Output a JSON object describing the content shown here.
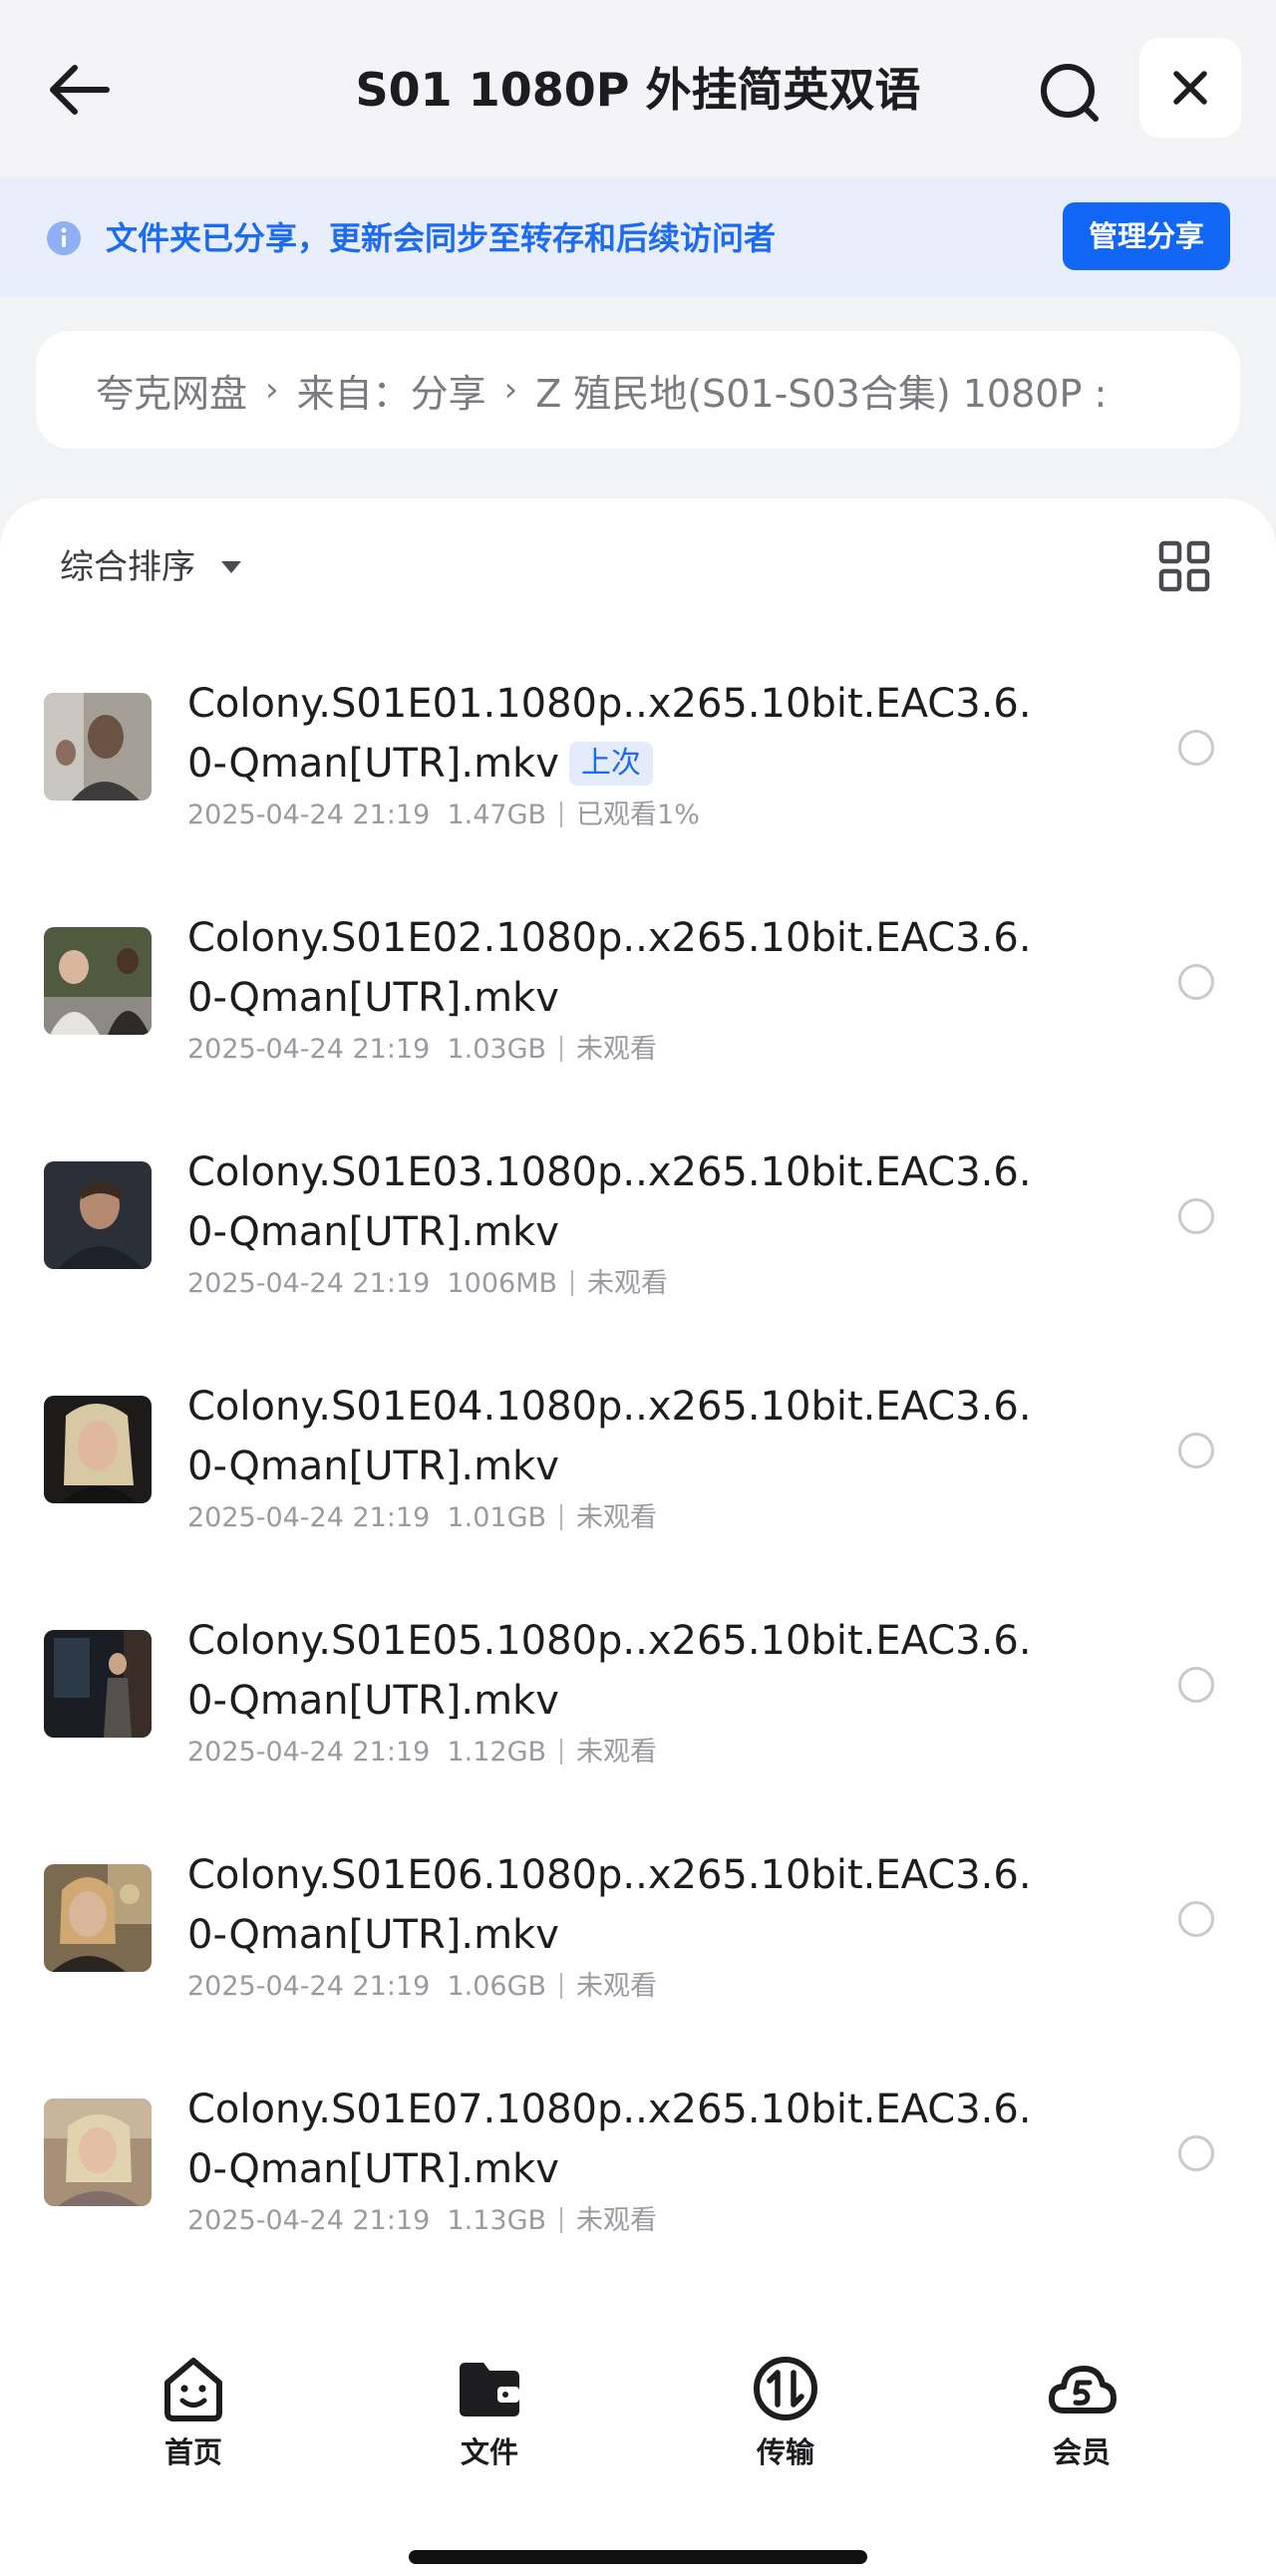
{
  "header": {
    "title": "S01 1080P 外挂简英双语"
  },
  "notice": {
    "text": "文件夹已分享，更新会同步至转存和后续访问者",
    "button": "管理分享"
  },
  "breadcrumb": {
    "items": [
      "夸克网盘",
      "来自：分享",
      "Z 殖民地(S01-S03合集) 1080P :"
    ]
  },
  "sort": {
    "label": "综合排序"
  },
  "files": [
    {
      "name": "Colony.S01E01.1080p..x265.10bit.EAC3.6.0-Qman[UTR].mkv",
      "date": "2025-04-24 21:19",
      "size": "1.47GB",
      "status": "已观看1%",
      "tag": "上次"
    },
    {
      "name": "Colony.S01E02.1080p..x265.10bit.EAC3.6.0-Qman[UTR].mkv",
      "date": "2025-04-24 21:19",
      "size": "1.03GB",
      "status": "未观看"
    },
    {
      "name": "Colony.S01E03.1080p..x265.10bit.EAC3.6.0-Qman[UTR].mkv",
      "date": "2025-04-24 21:19",
      "size": "1006MB",
      "status": "未观看"
    },
    {
      "name": "Colony.S01E04.1080p..x265.10bit.EAC3.6.0-Qman[UTR].mkv",
      "date": "2025-04-24 21:19",
      "size": "1.01GB",
      "status": "未观看"
    },
    {
      "name": "Colony.S01E05.1080p..x265.10bit.EAC3.6.0-Qman[UTR].mkv",
      "date": "2025-04-24 21:19",
      "size": "1.12GB",
      "status": "未观看"
    },
    {
      "name": "Colony.S01E06.1080p..x265.10bit.EAC3.6.0-Qman[UTR].mkv",
      "date": "2025-04-24 21:19",
      "size": "1.06GB",
      "status": "未观看"
    },
    {
      "name": "Colony.S01E07.1080p..x265.10bit.EAC3.6.0-Qman[UTR].mkv",
      "date": "2025-04-24 21:19",
      "size": "1.13GB",
      "status": "未观看"
    }
  ],
  "nav": {
    "items": [
      {
        "label": "首页",
        "icon": "home-face-icon"
      },
      {
        "label": "文件",
        "icon": "folder-icon"
      },
      {
        "label": "传输",
        "icon": "transfer-icon"
      },
      {
        "label": "会员",
        "icon": "member-cloud-icon"
      }
    ]
  },
  "colors": {
    "accent": "#1166f5",
    "notice_bg": "#e9eefc",
    "page_bg": "#f2f3f5"
  }
}
